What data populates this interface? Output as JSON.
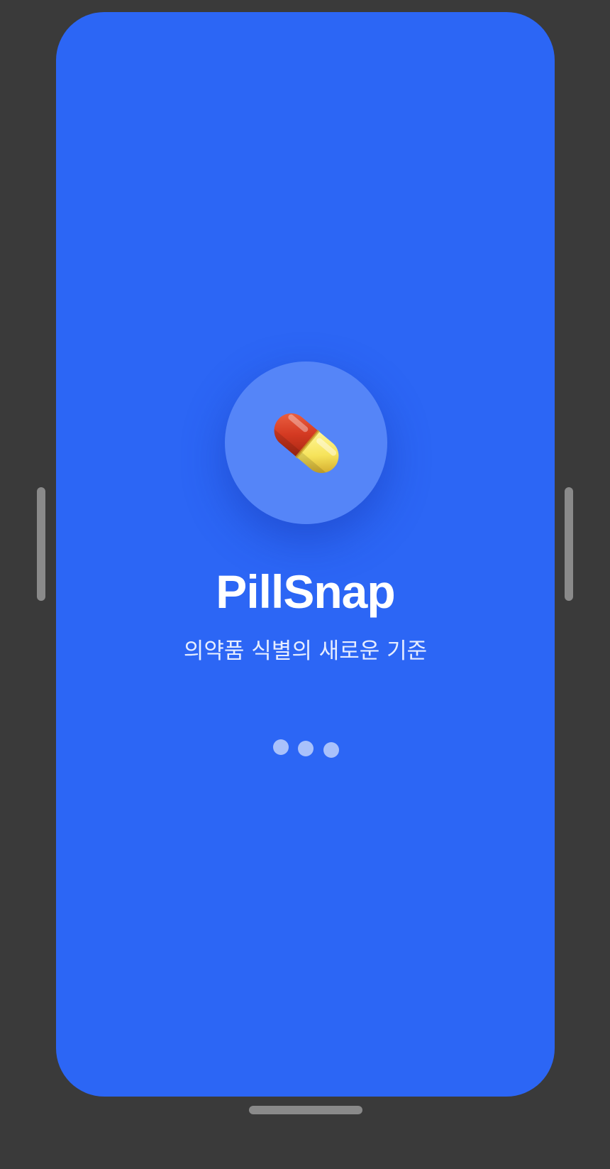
{
  "splash": {
    "app_name": "PillSnap",
    "tagline": "의약품 식별의 새로운 기준",
    "logo_icon": "pill-capsule-icon",
    "loading_indicator": {
      "dot_count": 3,
      "dot_color": "#a9c1fb"
    }
  },
  "colors": {
    "background": "#2c66f5",
    "logo_circle": "#5585f8",
    "text": "#ffffff",
    "device_frame": "#3a3a3a"
  }
}
